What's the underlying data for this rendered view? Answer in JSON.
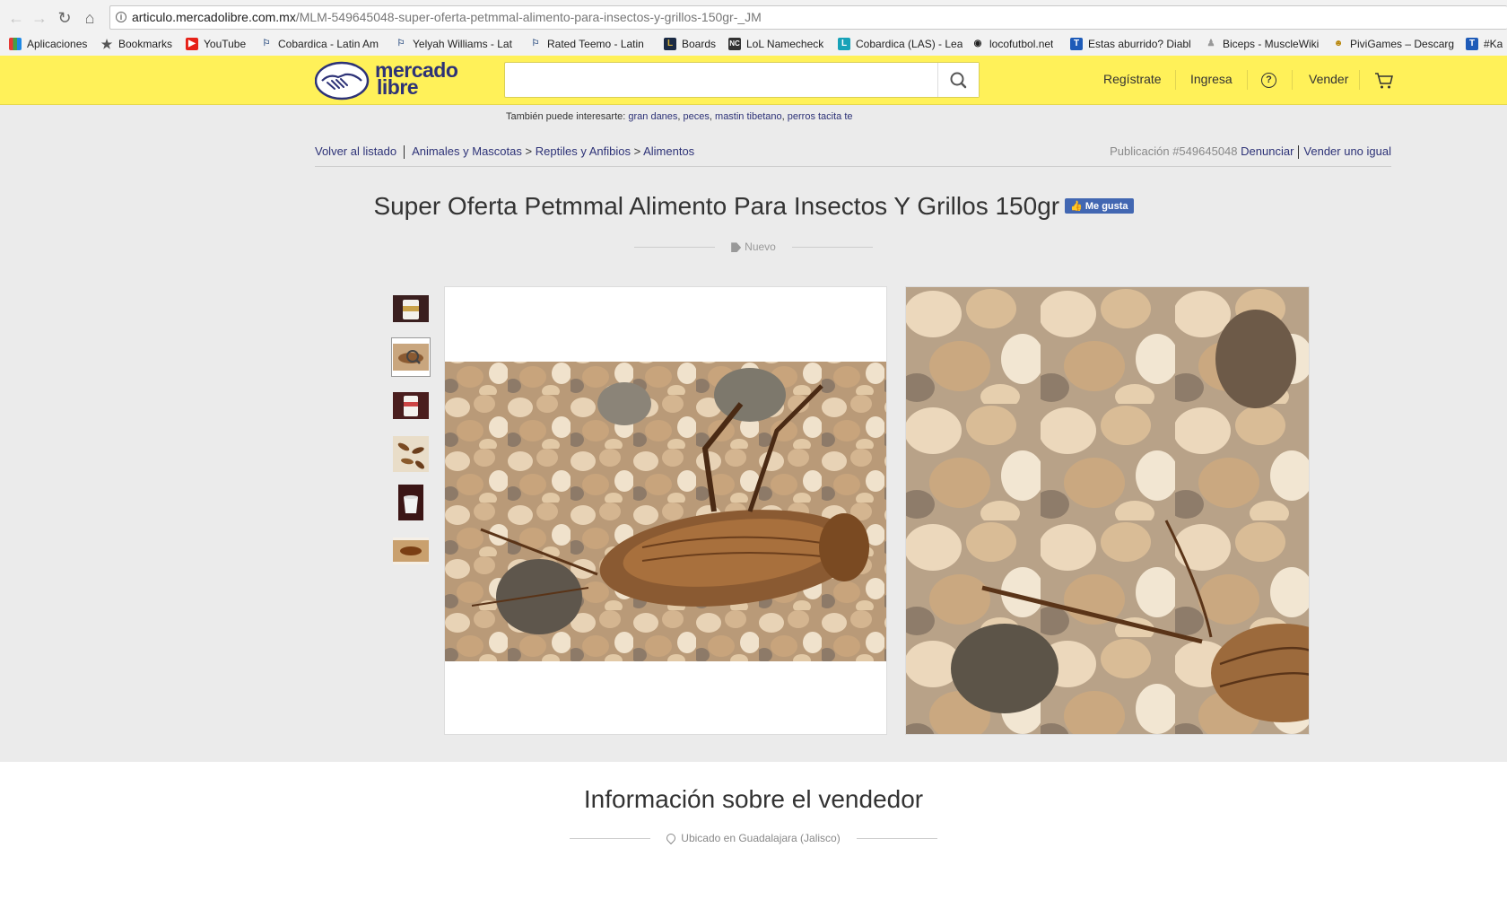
{
  "browser": {
    "url_domain": "articulo.mercadolibre.com.mx",
    "url_path": "/MLM-549645048-super-oferta-petmmal-alimento-para-insectos-y-grillos-150gr-_JM",
    "bookmarks": [
      "Aplicaciones",
      "Bookmarks",
      "YouTube",
      "Cobardica - Latin Am",
      "Yelyah Williams - Lat",
      "Rated Teemo - Latin",
      "Boards",
      "LoL Namecheck",
      "Cobardica (LAS) - Lea",
      "locofutbol.net",
      "Estas aburrido? Diabl",
      "Biceps - MuscleWiki",
      "PiviGames – Descarg",
      "#Ka"
    ]
  },
  "header": {
    "logo_line1": "mercado",
    "logo_line2": "libre",
    "search_placeholder": "",
    "register": "Regístrate",
    "login": "Ingresa",
    "sell": "Vender",
    "brand_color": "#fff159"
  },
  "suggest": {
    "label": "También puede interesarte:",
    "links": [
      "gran danes",
      "peces",
      "mastin tibetano",
      "perros tacita te"
    ]
  },
  "breadcrumb": {
    "back": "Volver al listado",
    "items": [
      "Animales y Mascotas",
      "Reptiles y Anfibios",
      "Alimentos"
    ],
    "separator": ">"
  },
  "publication": {
    "number": "Publicación #549645048",
    "report": "Denunciar",
    "sell_same": "Vender uno igual"
  },
  "product": {
    "title": "Super Oferta Petmmal Alimento Para Insectos Y Grillos 150gr",
    "like": "Me gusta",
    "condition": "Nuevo"
  },
  "seller": {
    "heading": "Información sobre el vendedor",
    "location": "Ubicado en Guadalajara (Jalisco)"
  }
}
